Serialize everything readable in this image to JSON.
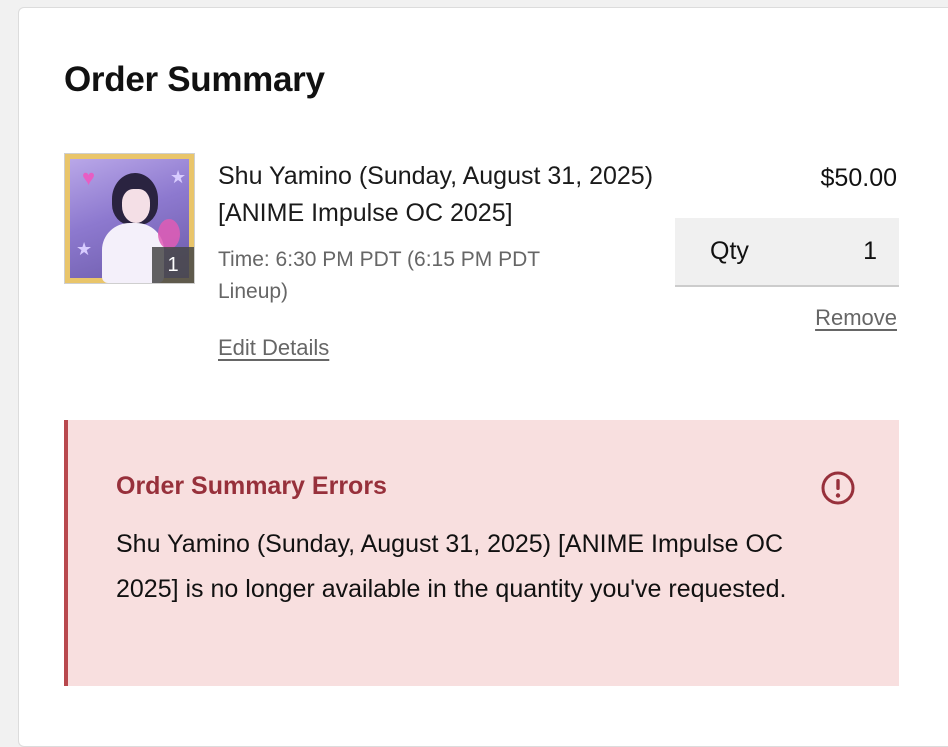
{
  "summary": {
    "title": "Order Summary"
  },
  "item": {
    "name": "Shu Yamino (Sunday, August 31, 2025) [ANIME Impulse OC 2025]",
    "time": "Time: 6:30 PM PDT (6:15 PM PDT Lineup)",
    "edit_label": "Edit Details",
    "price": "$50.00",
    "qty_label": "Qty",
    "qty_value": "1",
    "remove_label": "Remove",
    "thumb_badge": "1"
  },
  "errors": {
    "title": "Order Summary Errors",
    "message": "Shu Yamino (Sunday, August 31, 2025) [ANIME Impulse OC 2025] is no longer available in the quantity you've requested.",
    "icon": "alert-circle-icon"
  },
  "colors": {
    "error_bg": "#f8dfdf",
    "error_accent": "#b8484d",
    "error_title": "#97303b"
  }
}
